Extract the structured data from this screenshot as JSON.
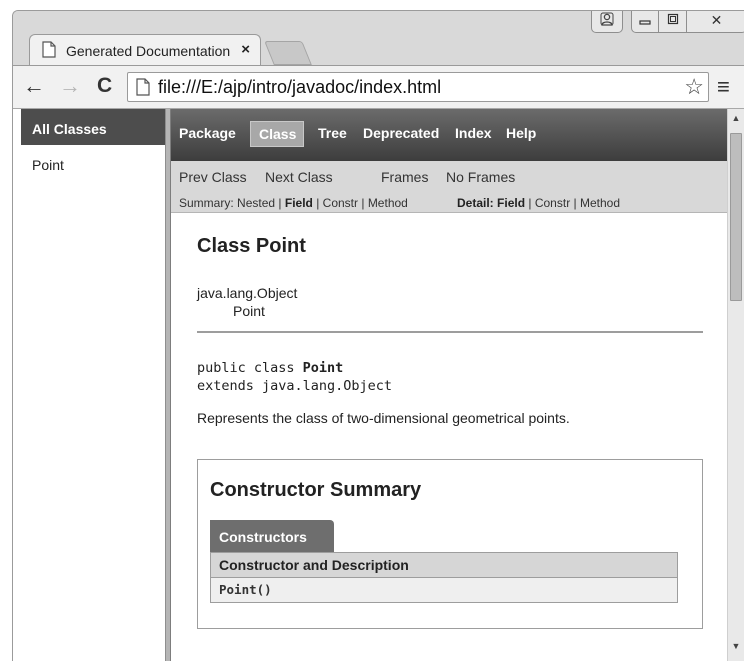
{
  "browser": {
    "tab_title": "Generated Documentation",
    "tab_close": "×",
    "url": "file:///E:/ajp/intro/javadoc/index.html",
    "icons": {
      "back": "arrow-left-icon",
      "forward": "arrow-right-icon",
      "reload": "reload-icon",
      "bookmark": "star-icon",
      "menu": "hamburger-menu-icon",
      "page": "document-icon",
      "user": "user-icon",
      "minimize": "minimize-icon",
      "maximize": "maximize-icon",
      "close": "close-icon"
    },
    "glyphs": {
      "back": "←",
      "forward": "→",
      "reload": "C",
      "star": "☆",
      "menu": "≡",
      "close": "✕"
    }
  },
  "left_frame": {
    "header": "All Classes",
    "items": [
      "Point"
    ]
  },
  "topnav": {
    "items": [
      "Package",
      "Class",
      "Tree",
      "Deprecated",
      "Index",
      "Help"
    ],
    "active": "Class"
  },
  "subnav": {
    "prev": "Prev Class",
    "next": "Next Class",
    "frames": "Frames",
    "no_frames": "No Frames",
    "summary_label": "Summary:",
    "summary_items": [
      "Nested",
      "Field",
      "Constr",
      "Method"
    ],
    "detail_label": "Detail:",
    "detail_items": [
      "Field",
      "Constr",
      "Method"
    ]
  },
  "content": {
    "class_title": "Class Point",
    "inheritance": [
      "java.lang.Object",
      "Point"
    ],
    "signature_prefix": "public class ",
    "signature_name": "Point",
    "signature_extends": "extends java.lang.Object",
    "description": "Represents the class of two-dimensional geometrical points.",
    "constructor_summary": {
      "title": "Constructor Summary",
      "tab": "Constructors",
      "header": "Constructor and Description",
      "rows": [
        "Point()"
      ]
    }
  },
  "colors": {
    "nav_bar": "#4d4d4d",
    "nav_active": "#a8a8a8",
    "subnav_bg": "#d8d8d8"
  }
}
